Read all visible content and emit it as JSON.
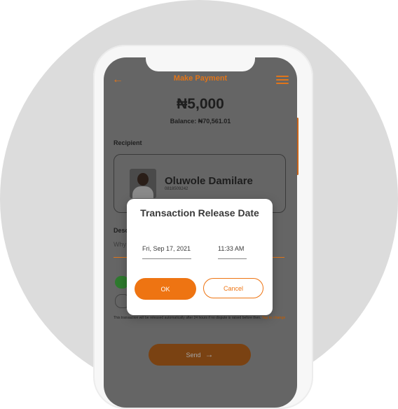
{
  "header": {
    "title": "Make Payment"
  },
  "payment": {
    "amount": "₦5,000",
    "balance": "Balance: ₦70,561.01"
  },
  "recipient": {
    "label": "Recipient",
    "name": "Oluwole Damilare",
    "account": "0818509242"
  },
  "description": {
    "label": "Desc",
    "placeholder": "Why"
  },
  "notice": {
    "text": "This transaction will be released automatically after 24 hours if no dispute is raised before then.",
    "link": "Tap to change"
  },
  "send": {
    "label": "Send"
  },
  "dialog": {
    "title": "Transaction Release Date",
    "date": "Fri, Sep 17, 2021",
    "time": "11:33 AM",
    "ok_label": "OK",
    "cancel_label": "Cancel"
  },
  "colors": {
    "accent": "#ee7412",
    "overlay": "#656565",
    "card": "#ffffff"
  },
  "icons": {
    "back": "arrow-left-icon",
    "menu": "hamburger-menu-icon",
    "send": "arrow-right-icon"
  }
}
